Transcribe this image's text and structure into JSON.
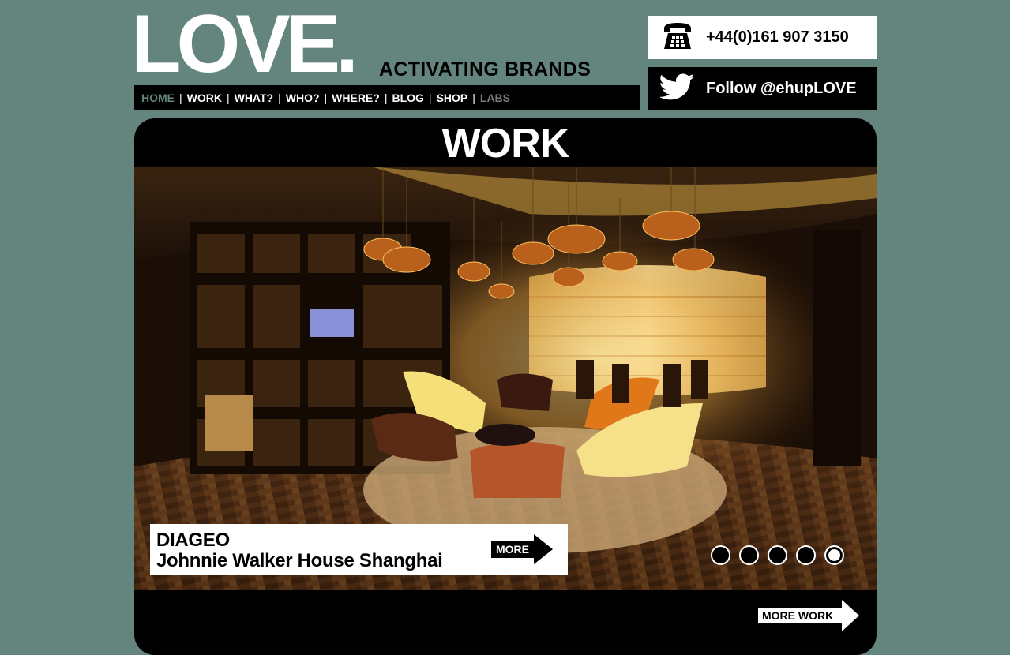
{
  "brand": {
    "logo_text": "LOVE.",
    "tagline": "ACTIVATING BRANDS"
  },
  "nav": {
    "items": [
      {
        "label": "HOME",
        "state": "active"
      },
      {
        "label": "WORK",
        "state": "normal"
      },
      {
        "label": "WHAT?",
        "state": "normal"
      },
      {
        "label": "WHO?",
        "state": "normal"
      },
      {
        "label": "WHERE?",
        "state": "normal"
      },
      {
        "label": "BLOG",
        "state": "normal"
      },
      {
        "label": "SHOP",
        "state": "normal"
      },
      {
        "label": "LABS",
        "state": "muted"
      }
    ],
    "separator": "|"
  },
  "contact": {
    "phone": "+44(0)161 907 3150",
    "phone_icon": "telephone-icon",
    "twitter": "Follow @ehupLOVE",
    "twitter_icon": "twitter-bird-icon"
  },
  "work": {
    "title": "WORK",
    "slide": {
      "client": "DIAGEO",
      "project": "Johnnie Walker House Shanghai",
      "more_label": "MORE"
    },
    "slider": {
      "total": 5,
      "active_index": 4
    },
    "more_work_label": "MORE WORK"
  },
  "colors": {
    "background": "#64857e",
    "panel": "#000000",
    "text_light": "#ffffff",
    "nav_active": "#64857e",
    "nav_muted": "#7b7b7b"
  }
}
